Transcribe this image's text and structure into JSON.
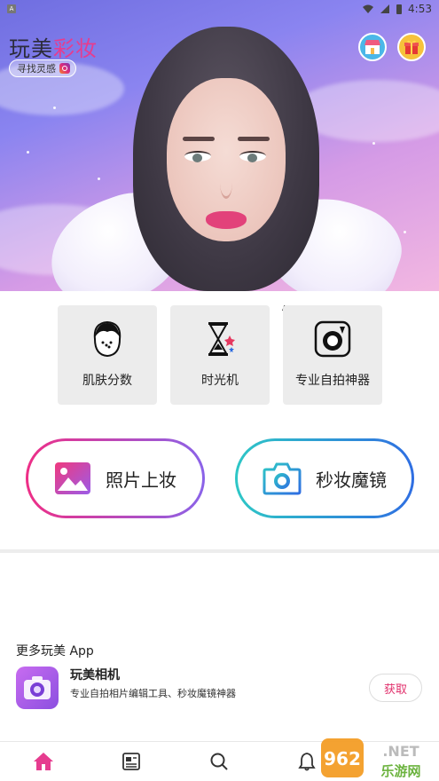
{
  "status_bar": {
    "time": "4:53"
  },
  "hero": {
    "brand_part1": "玩美",
    "brand_part2": "彩妆",
    "inspire_label": "寻找灵感"
  },
  "features": [
    {
      "label": "肌肤分数",
      "icon": "face-icon"
    },
    {
      "label": "时光机",
      "icon": "hourglass-icon"
    },
    {
      "label": "专业自拍神器",
      "icon": "camera-icon",
      "badge": "AD"
    }
  ],
  "actions": {
    "photo_makeup": "照片上妆",
    "instant_mirror": "秒妆魔镜"
  },
  "more_apps": {
    "title": "更多玩美 App",
    "app": {
      "name": "玩美相机",
      "desc": "专业自拍相片编辑工具、秒妆魔镜神器",
      "get_label": "获取"
    }
  },
  "watermark": {
    "text_top": "962.NET",
    "text_bottom": "乐游网"
  },
  "colors": {
    "accent_pink": "#e63c8f",
    "accent_teal": "#2ec7c6",
    "accent_blue": "#2f6ee2"
  }
}
